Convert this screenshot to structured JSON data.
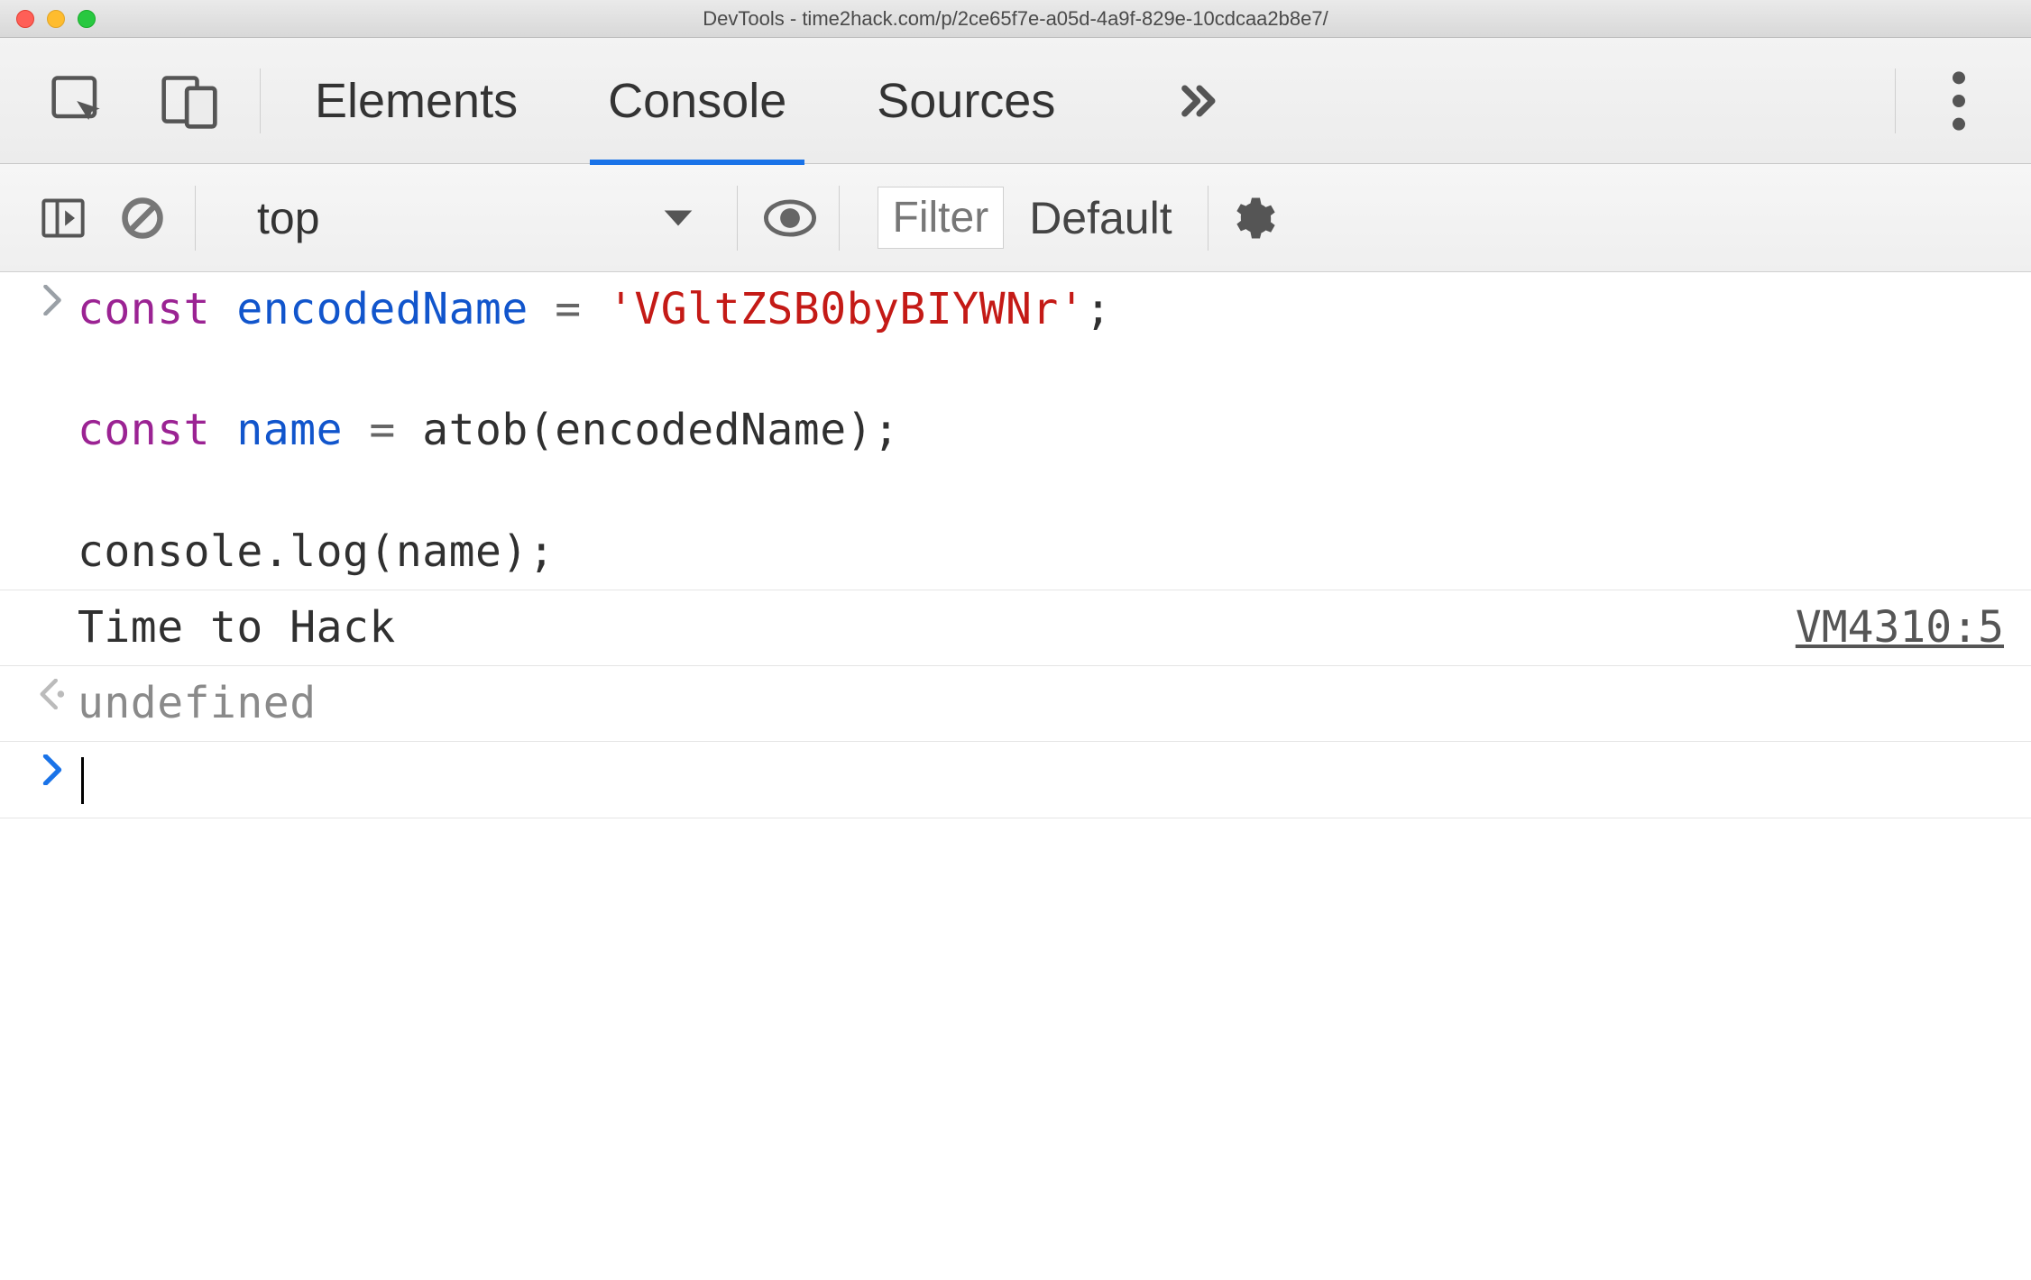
{
  "window": {
    "title": "DevTools - time2hack.com/p/2ce65f7e-a05d-4a9f-829e-10cdcaa2b8e7/"
  },
  "tabs": {
    "elements": "Elements",
    "console": "Console",
    "sources": "Sources"
  },
  "toolbar": {
    "context_label": "top",
    "filter_placeholder": "Filter",
    "levels_label": "Default"
  },
  "console": {
    "input": {
      "tokens": {
        "kw1": "const",
        "sp": " ",
        "id1": "encodedName",
        "eq": " = ",
        "str": "'VGltZSB0byBIYWNr'",
        "semi": ";",
        "blank": "",
        "kw2": "const",
        "id2": "name",
        "eq2": " = ",
        "fn1": "atob",
        "lp": "(",
        "arg1": "encodedName",
        "rp": ")",
        "semi2": ";",
        "fn2": "console",
        "dot": ".",
        "fn3": "log",
        "lp2": "(",
        "arg2": "name",
        "rp2": ")",
        "semi3": ";"
      }
    },
    "log": {
      "text": "Time to Hack",
      "source": "VM4310:5"
    },
    "return": {
      "text": "undefined"
    }
  }
}
